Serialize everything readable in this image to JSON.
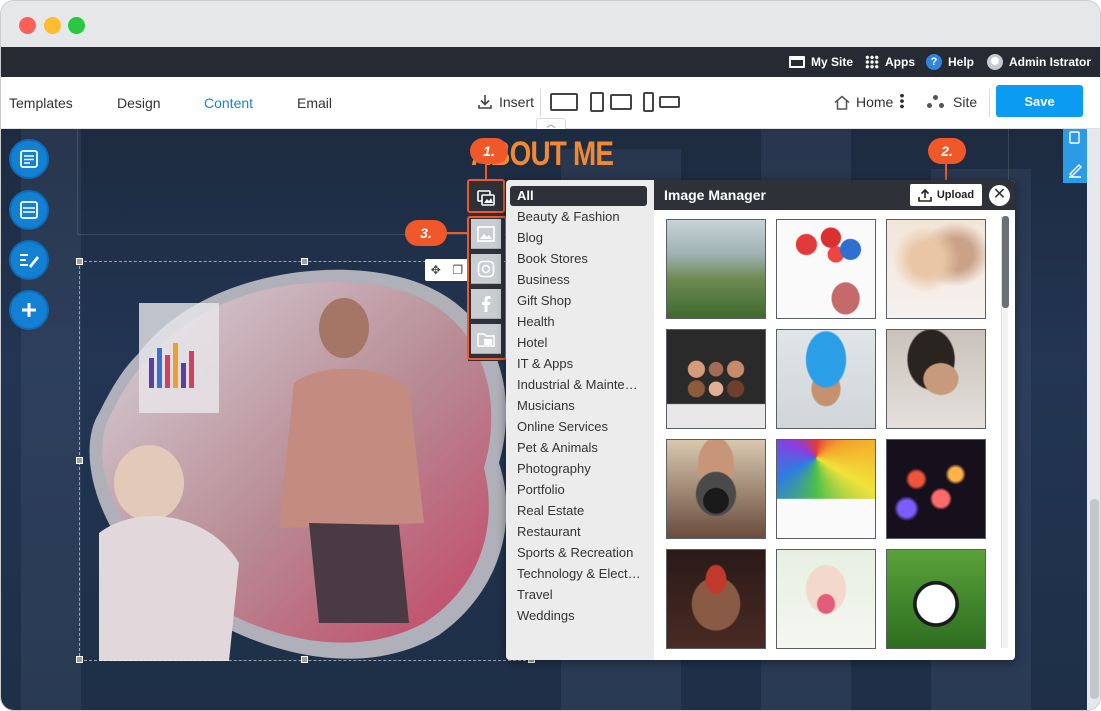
{
  "topbar": {
    "my_site": "My Site",
    "apps": "Apps",
    "help": "Help",
    "user": "Admin Istrator"
  },
  "toolbar": {
    "tabs": [
      "Templates",
      "Design",
      "Content",
      "Email"
    ],
    "active_tab": "Content",
    "insert": "Insert",
    "home": "Home",
    "site": "Site",
    "save": "Save"
  },
  "page": {
    "heading": "ABOUT ME"
  },
  "callouts": {
    "one": "1.",
    "two": "2.",
    "three": "3."
  },
  "image_manager": {
    "title": "Image Manager",
    "upload": "Upload",
    "close": "✕",
    "categories": [
      "All",
      "Beauty & Fashion",
      "Blog",
      "Book Stores",
      "Business",
      "Gift Shop",
      "Health",
      "Hotel",
      "IT & Apps",
      "Industrial & Mainte…",
      "Musicians",
      "Online Services",
      "Pet & Animals",
      "Photography",
      "Portfolio",
      "Real Estate",
      "Restaurant",
      "Sports & Recreation",
      "Technology & Elect…",
      "Travel",
      "Weddings"
    ],
    "selected_category": "All"
  },
  "colors": {
    "accent": "#0b9bf0",
    "callout": "#f0582a",
    "heading": "#f18834",
    "dark_panel": "#2e3138"
  }
}
